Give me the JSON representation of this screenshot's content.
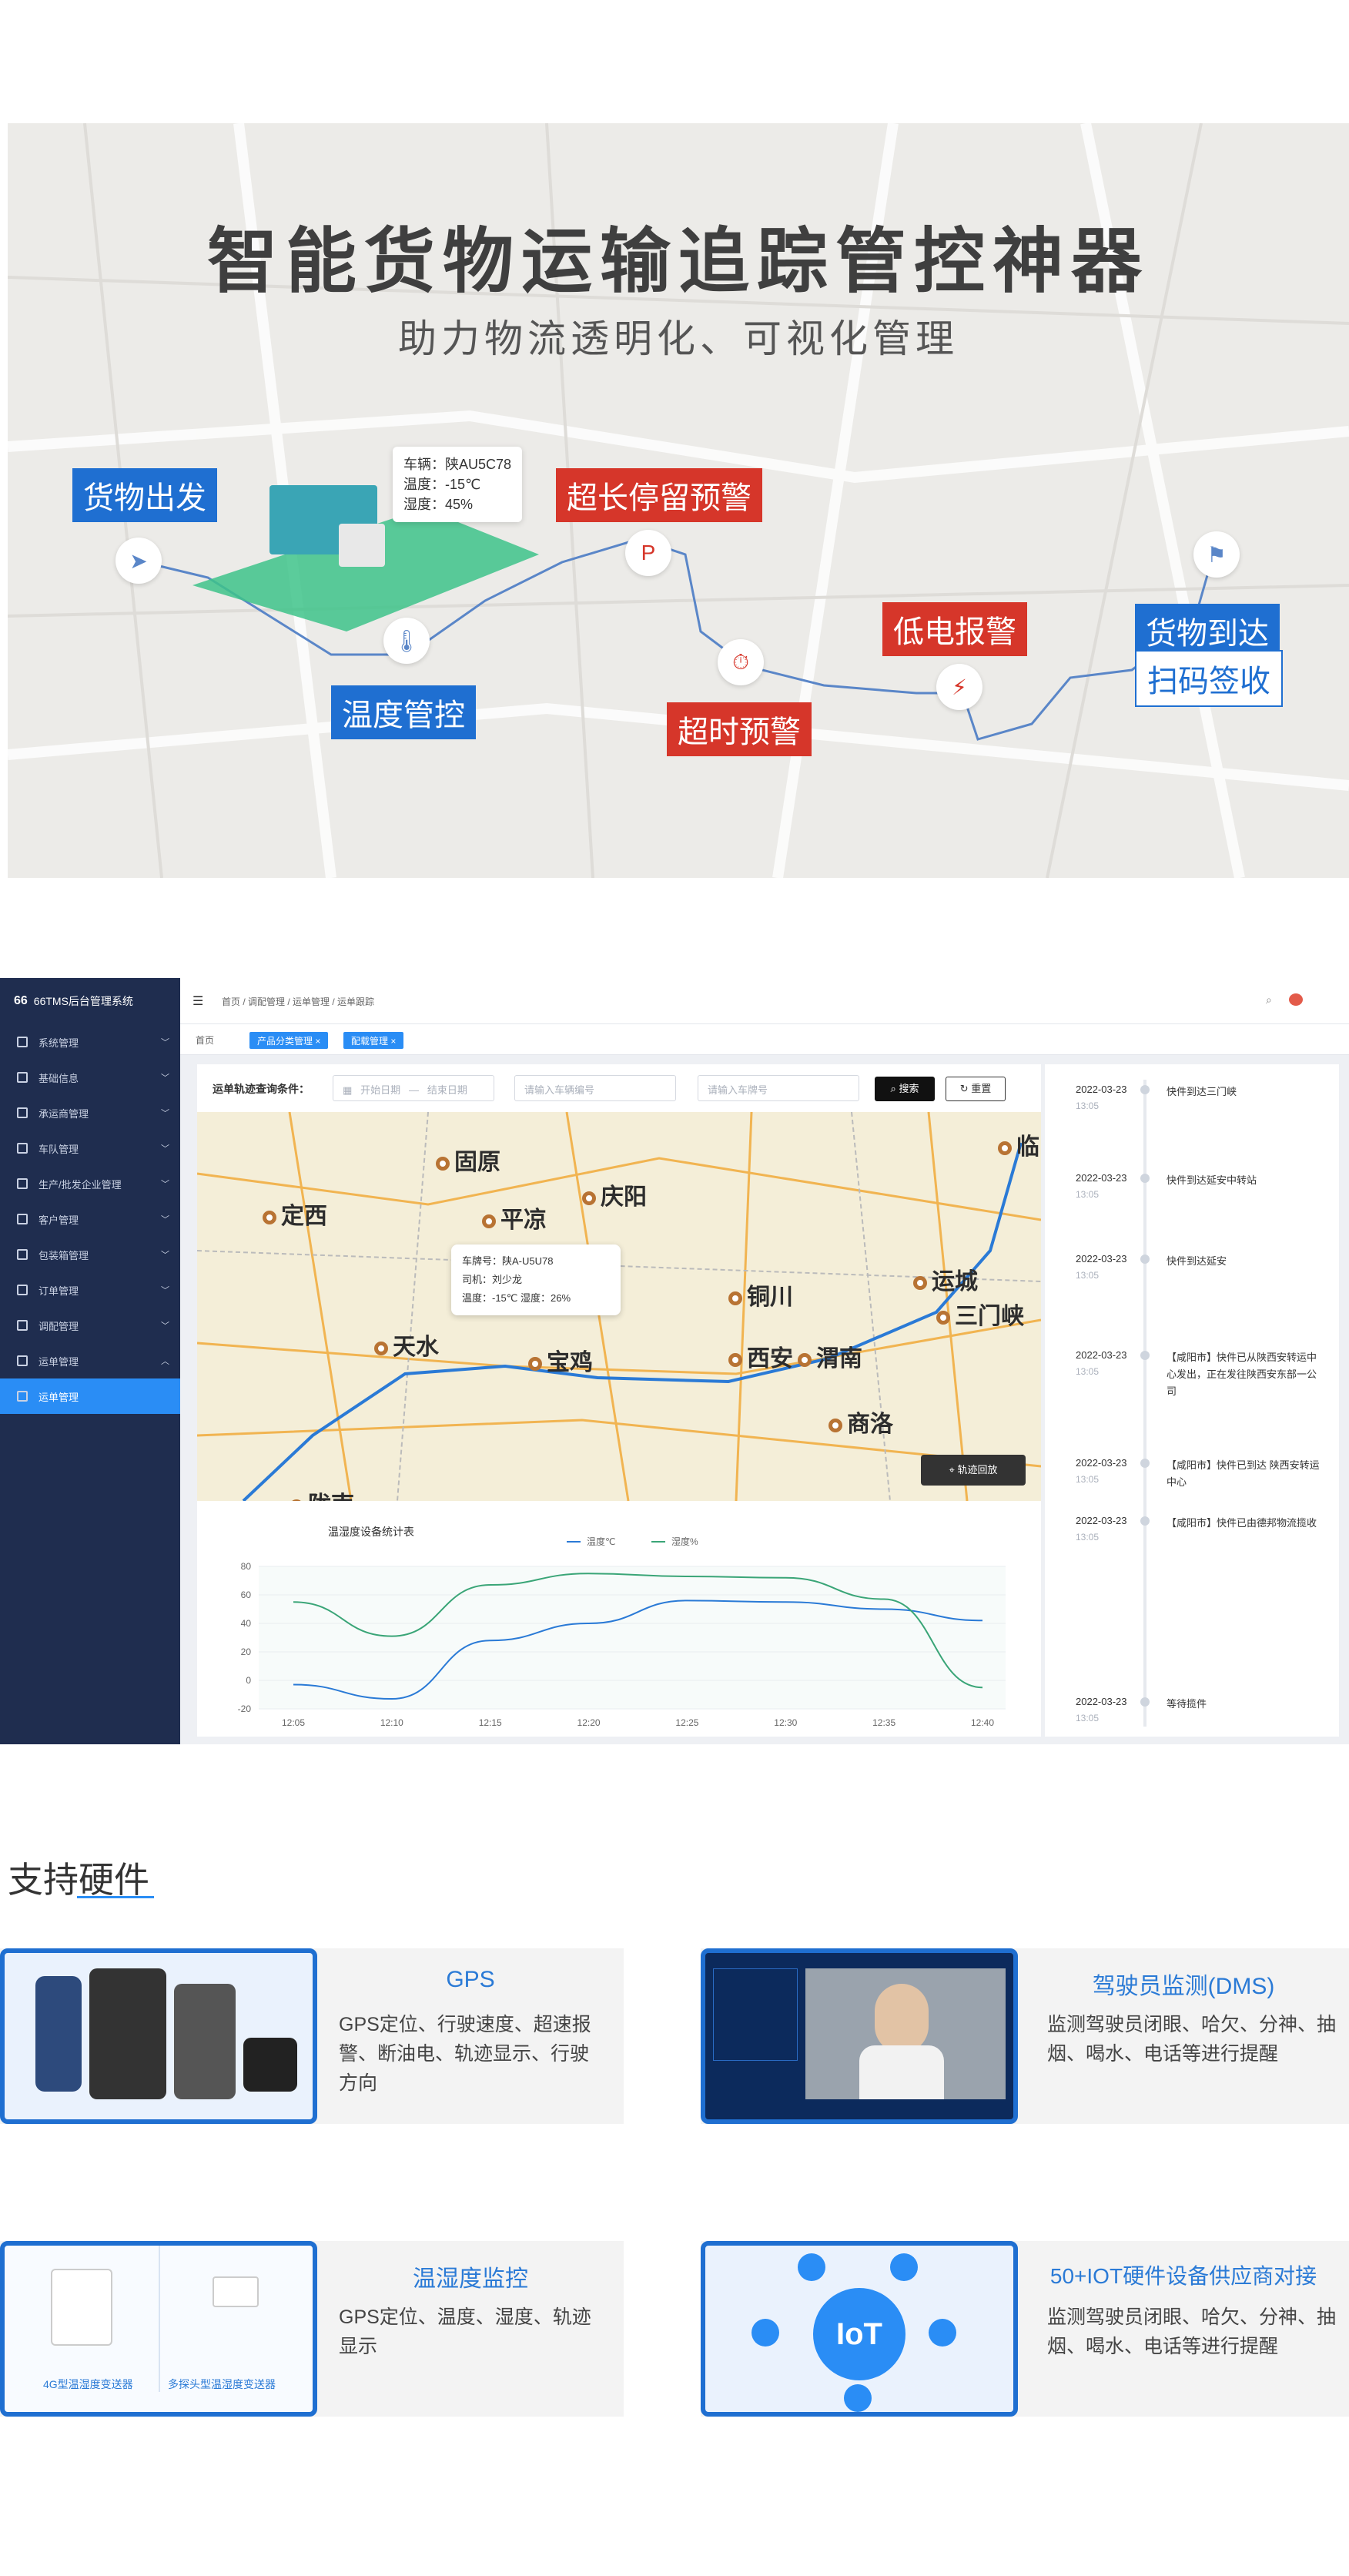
{
  "hero": {
    "title": "智能货物运输追踪管控神器",
    "subtitle": "助力物流透明化、可视化管理",
    "tags": {
      "depart": "货物出发",
      "temp": "温度管控",
      "long_stay": "超长停留预警",
      "timeout": "超时预警",
      "low_battery": "低电报警",
      "arrive": "货物到达",
      "scan_sign": "扫码签收"
    },
    "truck_card": {
      "plate": "车辆：陕AU5C78",
      "temp": "温度：-15℃",
      "humidity": "湿度：45%"
    }
  },
  "dashboard": {
    "brand": "66TMS后台管理系统",
    "breadcrumb": "首页 / 调配管理 / 运单管理 / 运单跟踪",
    "home_tab": "首页",
    "tabs": [
      "产品分类管理 ×",
      "配载管理 ×"
    ],
    "sidebar": [
      {
        "label": "系统管理"
      },
      {
        "label": "基础信息"
      },
      {
        "label": "承运商管理"
      },
      {
        "label": "车队管理"
      },
      {
        "label": "生产/批发企业管理"
      },
      {
        "label": "客户管理"
      },
      {
        "label": "包装箱管理"
      },
      {
        "label": "订单管理"
      },
      {
        "label": "调配管理"
      },
      {
        "label": "运单管理"
      },
      {
        "label": "运单管理"
      }
    ],
    "query": {
      "label": "运单轨迹查询条件：",
      "start_placeholder": "开始日期",
      "sep": "—",
      "end_placeholder": "结束日期",
      "vehicle_placeholder": "请输入车辆编号",
      "plate_placeholder": "请输入车牌号",
      "search": "搜索",
      "reset": "重置"
    },
    "map": {
      "cities": [
        "固原",
        "庆阳",
        "定西",
        "平凉",
        "临",
        "铜川",
        "运城",
        "三门峡",
        "天水",
        "宝鸡",
        "西安",
        "渭南",
        "商洛",
        "陇南"
      ],
      "popup": {
        "plate": "车牌号：陕A-U5U78",
        "driver": "司机：刘少龙",
        "reading": "温度：-15℃  湿度：26%"
      },
      "replay": "轨迹回放"
    },
    "timeline": [
      {
        "date": "2022-03-23",
        "time": "13:05",
        "text": "快件到达三门峡"
      },
      {
        "date": "2022-03-23",
        "time": "13:05",
        "text": "快件到达延安中转站"
      },
      {
        "date": "2022-03-23",
        "time": "13:05",
        "text": "快件到达延安"
      },
      {
        "date": "2022-03-23",
        "time": "13:05",
        "text": "【咸阳市】快件已从陕西安转运中心发出，正在发往陕西安东部一公司"
      },
      {
        "date": "2022-03-23",
        "time": "13:05",
        "text": "【咸阳市】快件已到达 陕西安转运中心"
      },
      {
        "date": "2022-03-23",
        "time": "13:05",
        "text": "【咸阳市】快件已由德邦物流揽收"
      },
      {
        "date": "2022-03-23",
        "time": "13:05",
        "text": "等待揽件"
      }
    ]
  },
  "chart_data": {
    "type": "line",
    "title": "温湿度设备统计表",
    "categories": [
      "12:05",
      "12:10",
      "12:15",
      "12:20",
      "12:25",
      "12:30",
      "12:35",
      "12:40"
    ],
    "series": [
      {
        "name": "温度℃",
        "values": [
          -3,
          -13,
          28,
          40,
          56,
          55,
          50,
          42
        ]
      },
      {
        "name": "湿度%",
        "values": [
          55,
          31,
          67,
          75,
          73,
          72,
          57,
          -5
        ]
      }
    ],
    "ylim": [
      -20,
      80
    ],
    "yticks": [
      80,
      60,
      40,
      20,
      0,
      -20
    ],
    "colors": [
      "#2a7ad6",
      "#3aa577"
    ]
  },
  "hardware": {
    "title": "支持硬件",
    "items": [
      {
        "name": "GPS",
        "desc": "GPS定位、行驶速度、超速报警、断油电、轨迹显示、行驶方向"
      },
      {
        "name": "驾驶员监测(DMS)",
        "desc": "监测驾驶员闭眼、哈欠、分神、抽烟、喝水、电话等进行提醒"
      },
      {
        "name": "温湿度监控",
        "desc": "GPS定位、温度、湿度、轨迹显示",
        "img_labels": [
          "4G型温湿度变送器",
          "多探头型温湿度变送器"
        ]
      },
      {
        "name": "50+IOT硬件设备供应商对接",
        "desc": "监测驾驶员闭眼、哈欠、分神、抽烟、喝水、电话等进行提醒",
        "img_label": "IoT"
      }
    ]
  }
}
